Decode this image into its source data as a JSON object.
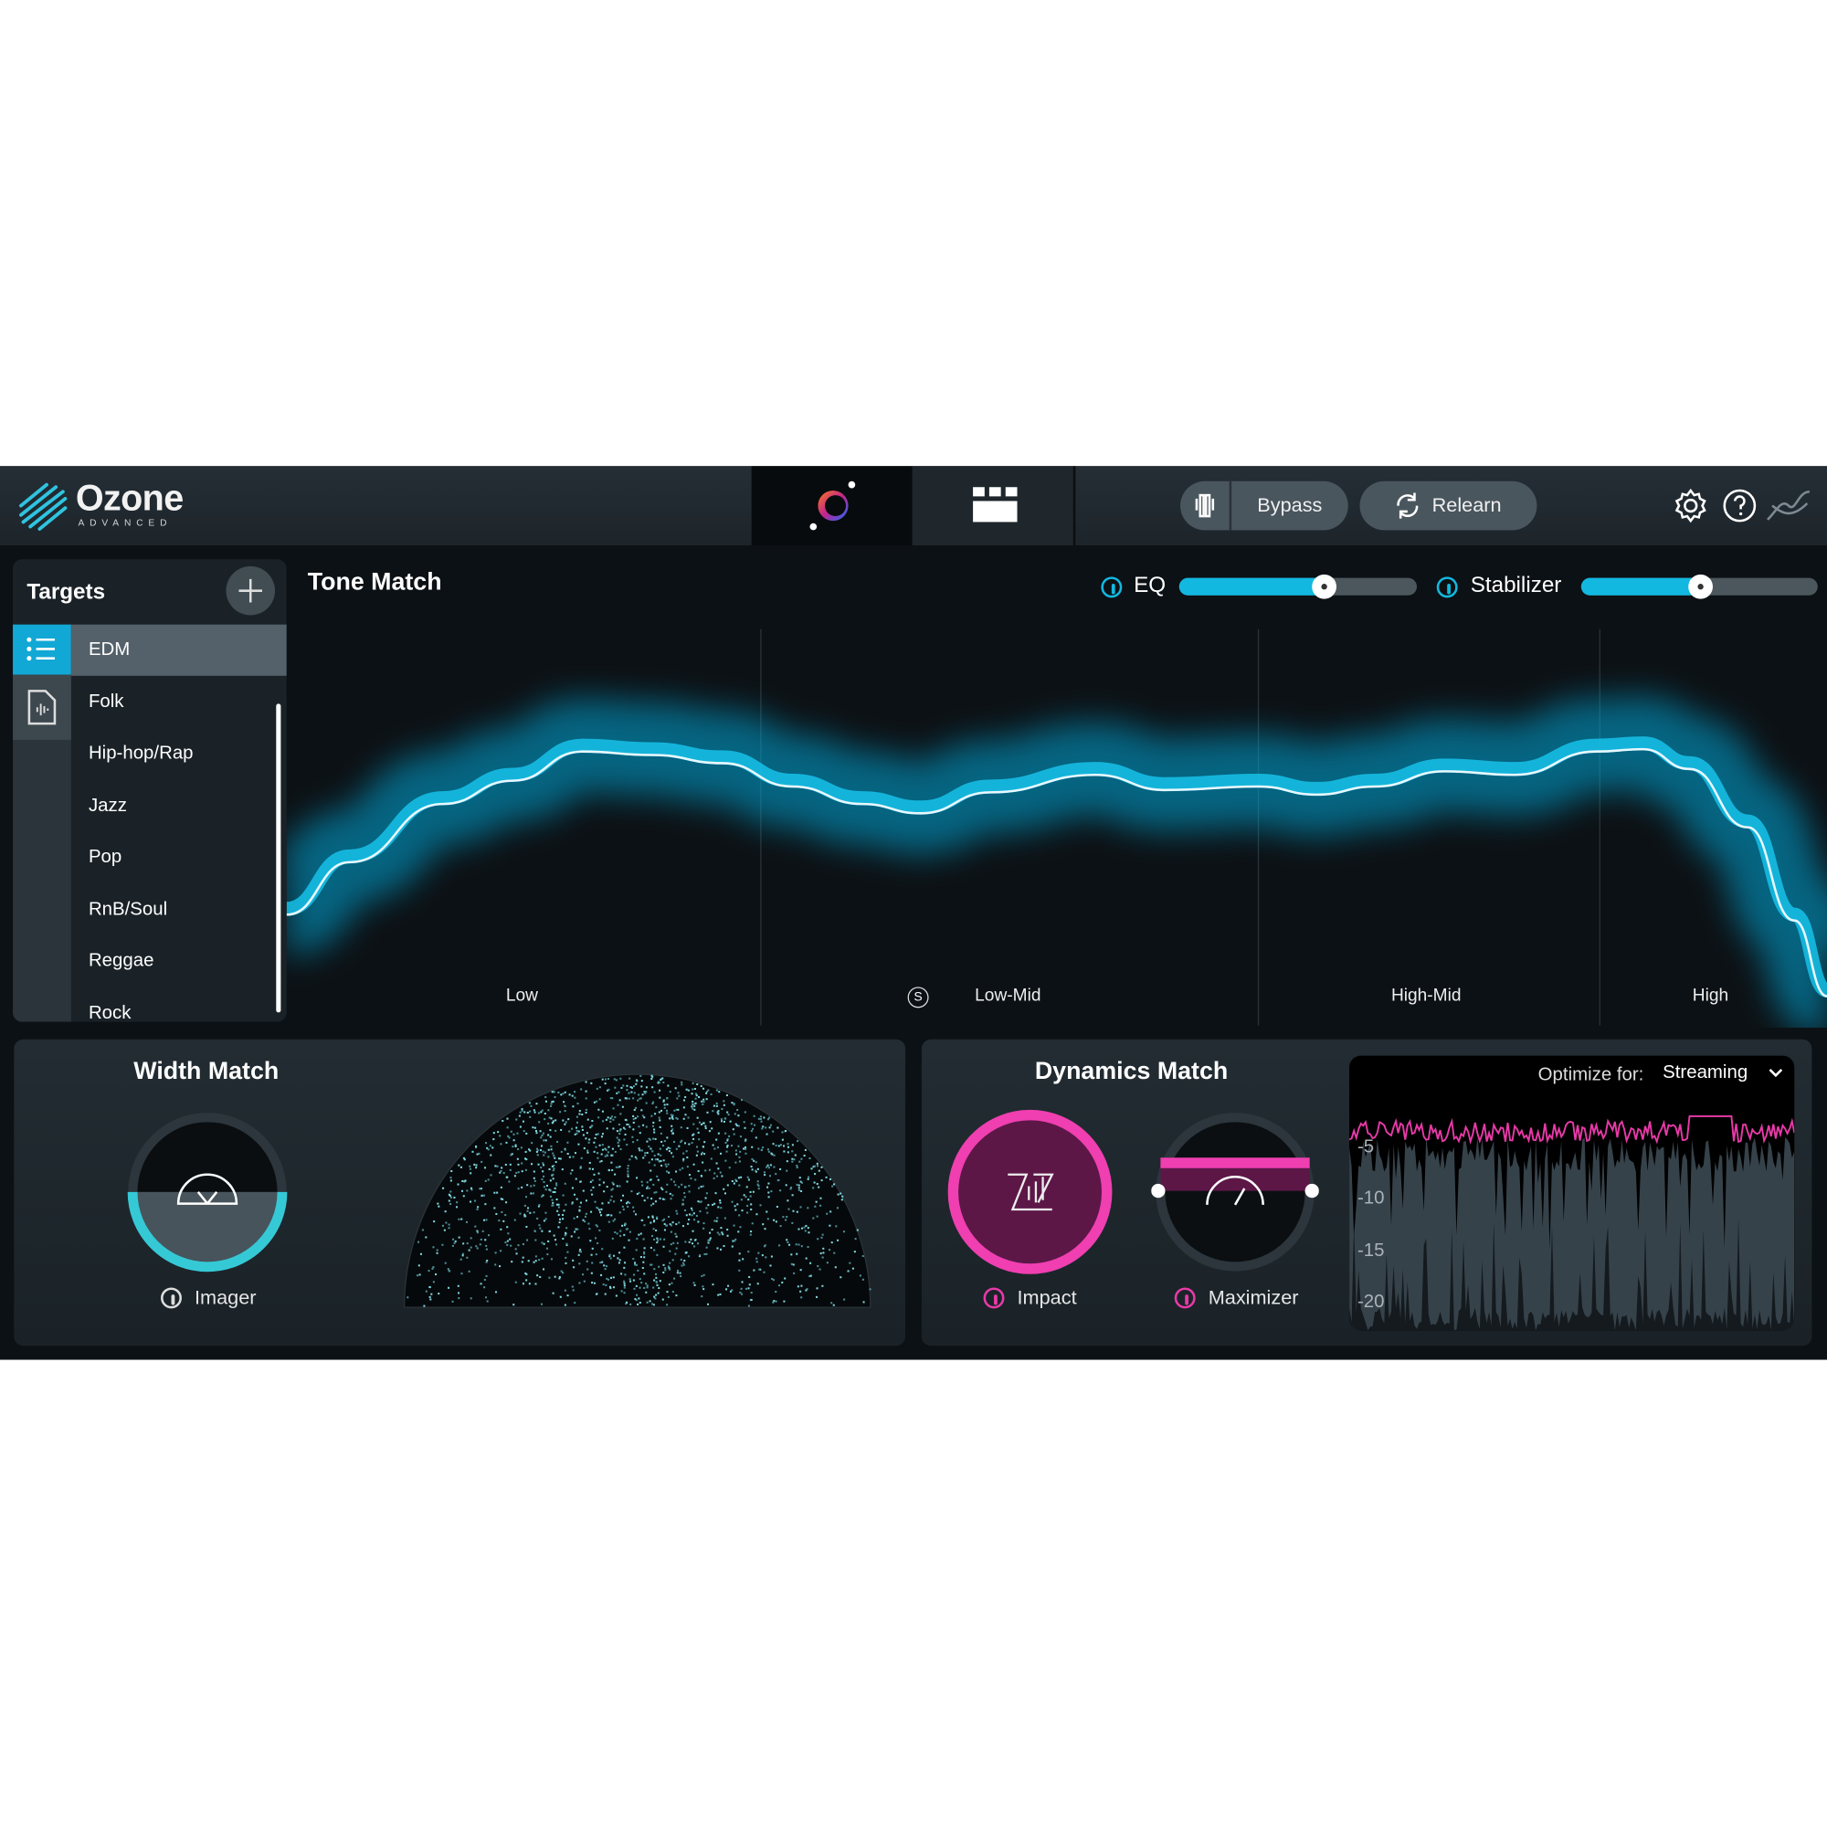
{
  "header": {
    "app_name": "Ozone",
    "edition": "ADVANCED",
    "bypass_label": "Bypass",
    "relearn_label": "Relearn",
    "icons": [
      "ozone-logo-icon",
      "assistant-orb-icon",
      "module-grid-icon",
      "bypass-compare-icon",
      "relearn-icon",
      "gear-icon",
      "help-icon",
      "signal-path-icon"
    ]
  },
  "targets": {
    "title": "Targets",
    "add_icon": "plus-icon",
    "items": [
      {
        "label": "EDM",
        "selected": true
      },
      {
        "label": "Folk"
      },
      {
        "label": "Hip-hop/Rap"
      },
      {
        "label": "Jazz"
      },
      {
        "label": "Pop"
      },
      {
        "label": "RnB/Soul"
      },
      {
        "label": "Reggae"
      },
      {
        "label": "Rock"
      }
    ]
  },
  "tone_match": {
    "title": "Tone Match",
    "eq_label": "EQ",
    "eq_amount": 0.61,
    "stabilizer_label": "Stabilizer",
    "stabilizer_amount": 0.5,
    "bands": [
      "Low",
      "Low-Mid",
      "High-Mid",
      "High"
    ],
    "solo_label": "S",
    "accent": "#12b8e0"
  },
  "width_match": {
    "title": "Width Match",
    "module_label": "Imager",
    "accent": "#35c9d6"
  },
  "dynamics_match": {
    "title": "Dynamics Match",
    "impact_label": "Impact",
    "maximizer_label": "Maximizer",
    "accent": "#e83aa8",
    "optimize_label": "Optimize for:",
    "optimize_value": "Streaming",
    "y_ticks": [
      "-5",
      "-10",
      "-15",
      "-20"
    ]
  }
}
